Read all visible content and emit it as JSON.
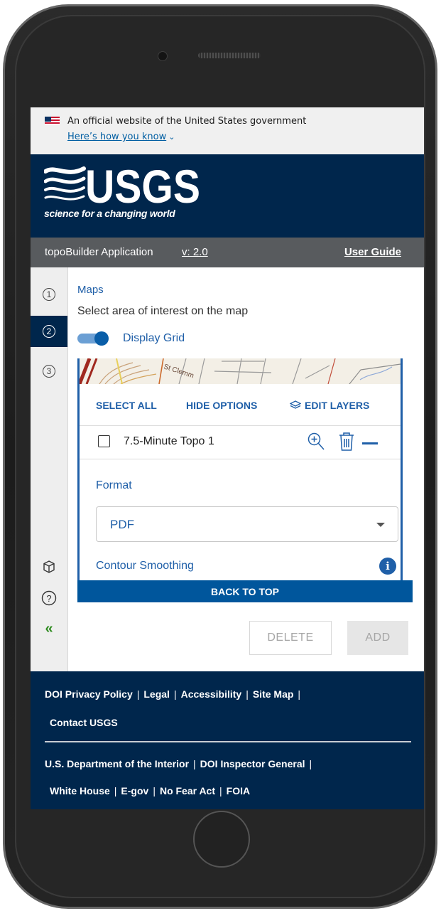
{
  "gov_banner": {
    "text": "An official website of the United States government",
    "link_text": "Here’s how you know"
  },
  "brand": {
    "logo_text": "USGS",
    "tagline": "science for a changing world"
  },
  "app_bar": {
    "title": "topoBuilder Application",
    "version": "v: 2.0",
    "user_guide": "User Guide"
  },
  "steps": [
    "1",
    "2",
    "3"
  ],
  "active_step": "2",
  "content": {
    "section_title": "Maps",
    "instruction": "Select area of interest on the map",
    "display_grid_label": "Display Grid",
    "display_grid_on": true
  },
  "options": {
    "select_all": "SELECT ALL",
    "hide_options": "HIDE OPTIONS",
    "edit_layers": "EDIT LAYERS"
  },
  "layer": {
    "name": "7.5-Minute Topo 1",
    "checked": false
  },
  "format": {
    "label": "Format",
    "value": "PDF"
  },
  "contour_smoothing_label": "Contour Smoothing",
  "back_to_top": "BACK TO TOP",
  "buttons": {
    "delete": "DELETE",
    "add": "ADD"
  },
  "map_label": "St Clemm",
  "footer": {
    "row1": [
      "DOI Privacy Policy",
      "Legal",
      "Accessibility",
      "Site Map"
    ],
    "row2": [
      "Contact USGS"
    ],
    "row3": [
      "U.S. Department of the Interior",
      "DOI Inspector General"
    ],
    "row4": [
      "White House",
      "E-gov",
      "No Fear Act",
      "FOIA"
    ]
  },
  "colors": {
    "usgs_navy": "#00264c",
    "link_blue": "#1f5fa8",
    "app_bar_gray": "#585b5e",
    "collapse_green": "#2e8b1f"
  },
  "icons": {
    "flag": "us-flag-icon",
    "chevron": "chevron-down-icon",
    "layers": "layers-icon",
    "zoom": "zoom-in-icon",
    "trash": "trash-icon",
    "minus": "minus-icon",
    "info": "info-icon",
    "cube": "cube-icon",
    "help": "help-icon",
    "collapse": "double-chevron-left-icon"
  }
}
